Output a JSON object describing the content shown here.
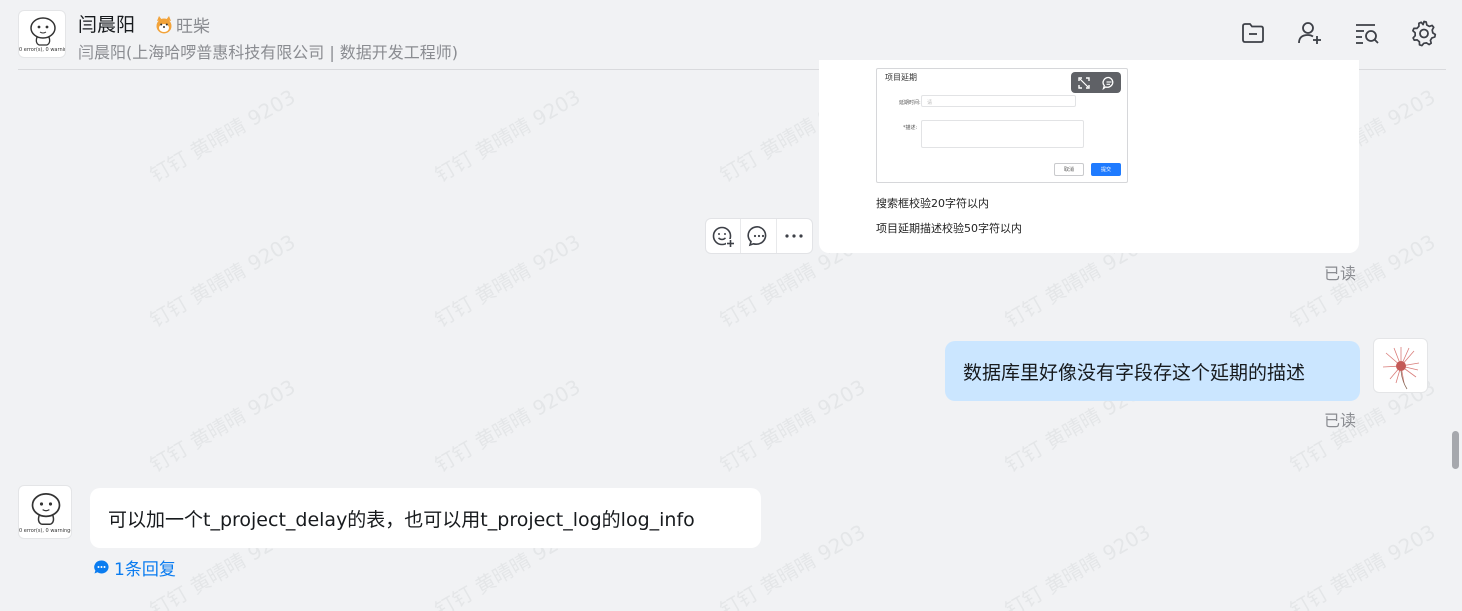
{
  "header": {
    "contact_name": "闫晨阳",
    "contact_tag": "旺柴",
    "contact_subtitle": "闫晨阳(上海哈啰普惠科技有限公司 | 数据开发工程师)",
    "avatar_caption": "0 error(s), 0 warning(s)",
    "toolbar": [
      "folder-icon",
      "add-member-icon",
      "search-history-icon",
      "settings-icon"
    ]
  },
  "watermark": "钉钉 黄晴晴 9203",
  "messages": {
    "image_card": {
      "dialog_title": "项目延期",
      "dialog_field1_label": "延期时间:",
      "dialog_field1_placeholder": "请",
      "dialog_field2_label": "*描述:",
      "dialog_cancel": "取消",
      "dialog_confirm": "提交",
      "line1": "搜索框校验20字符以内",
      "line2": "项目延期描述校验50字符以内",
      "read_status": "已读"
    },
    "outgoing": {
      "text": "数据库里好像没有字段存这个延期的描述",
      "read_status": "已读"
    },
    "incoming": {
      "text": "可以加一个t_project_delay的表，也可以用t_project_log的log_info",
      "avatar_caption": "0 error(s), 0 warning(s)",
      "reply_label": "1条回复"
    }
  },
  "colors": {
    "background": "#f1f2f4",
    "outgoing_bubble": "#cbe6ff",
    "link": "#0a7cf0"
  }
}
